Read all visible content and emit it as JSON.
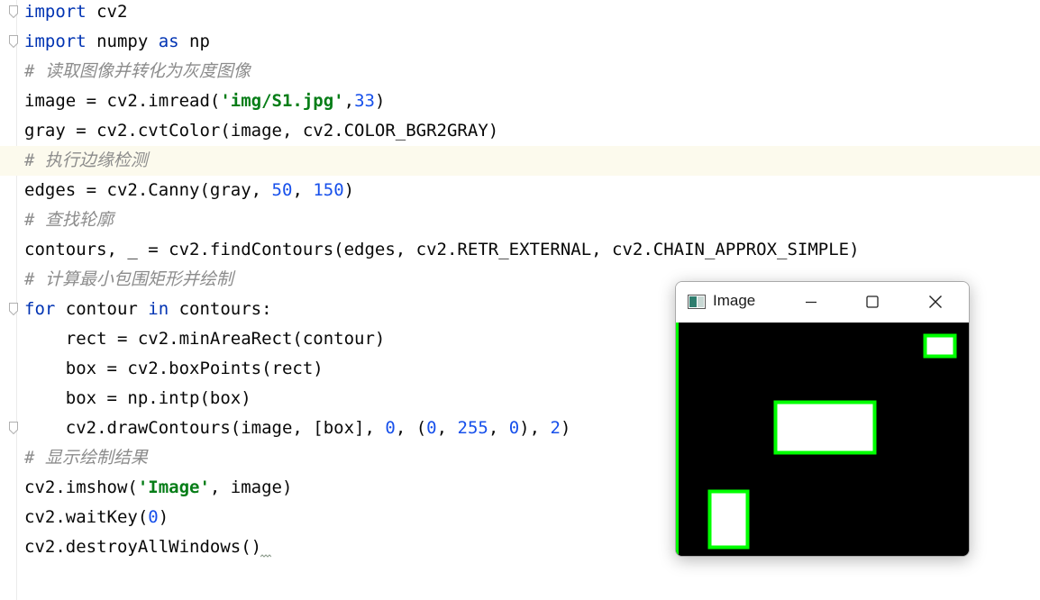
{
  "editor": {
    "lines": [
      {
        "tokens": [
          {
            "t": "import",
            "c": "kw"
          },
          {
            "t": " cv2",
            "c": ""
          }
        ]
      },
      {
        "tokens": [
          {
            "t": "import",
            "c": "kw"
          },
          {
            "t": " numpy ",
            "c": ""
          },
          {
            "t": "as",
            "c": "kw"
          },
          {
            "t": " np",
            "c": ""
          }
        ]
      },
      {
        "tokens": [
          {
            "t": "# 读取图像并转化为灰度图像",
            "c": "cmt"
          }
        ]
      },
      {
        "tokens": [
          {
            "t": "image = cv2.imread(",
            "c": ""
          },
          {
            "t": "'img/S1.jpg'",
            "c": "str"
          },
          {
            "t": ",",
            "c": ""
          },
          {
            "t": "33",
            "c": "num"
          },
          {
            "t": ")",
            "c": ""
          }
        ]
      },
      {
        "tokens": [
          {
            "t": "gray = cv2.cvtColor(image, cv2.COLOR_BGR2GRAY)",
            "c": ""
          }
        ]
      },
      {
        "tokens": [
          {
            "t": "# 执行边缘检测",
            "c": "cmt"
          }
        ]
      },
      {
        "tokens": [
          {
            "t": "edges = cv2.Canny(gray, ",
            "c": ""
          },
          {
            "t": "50",
            "c": "num"
          },
          {
            "t": ", ",
            "c": ""
          },
          {
            "t": "150",
            "c": "num"
          },
          {
            "t": ")",
            "c": ""
          }
        ]
      },
      {
        "tokens": [
          {
            "t": "# 查找轮廓",
            "c": "cmt"
          }
        ]
      },
      {
        "tokens": [
          {
            "t": "contours, _ = cv2.findContours(edges, cv2.RETR_EXTERNAL, cv2.CHAIN_APPROX_SIMPLE)",
            "c": ""
          }
        ]
      },
      {
        "tokens": [
          {
            "t": "# 计算最小包围矩形并绘制",
            "c": "cmt"
          }
        ]
      },
      {
        "tokens": [
          {
            "t": "for",
            "c": "kw"
          },
          {
            "t": " contour ",
            "c": ""
          },
          {
            "t": "in",
            "c": "kw"
          },
          {
            "t": " contours:",
            "c": ""
          }
        ]
      },
      {
        "tokens": [
          {
            "t": "    rect = cv2.minAreaRect(contour)",
            "c": ""
          }
        ]
      },
      {
        "tokens": [
          {
            "t": "    box = cv2.boxPoints(rect)",
            "c": ""
          }
        ]
      },
      {
        "tokens": [
          {
            "t": "    box = np.intp(box)",
            "c": ""
          }
        ]
      },
      {
        "tokens": [
          {
            "t": "    cv2.drawContours(image, [box], ",
            "c": ""
          },
          {
            "t": "0",
            "c": "num"
          },
          {
            "t": ", (",
            "c": ""
          },
          {
            "t": "0",
            "c": "num"
          },
          {
            "t": ", ",
            "c": ""
          },
          {
            "t": "255",
            "c": "num"
          },
          {
            "t": ", ",
            "c": ""
          },
          {
            "t": "0",
            "c": "num"
          },
          {
            "t": "), ",
            "c": ""
          },
          {
            "t": "2",
            "c": "num"
          },
          {
            "t": ")",
            "c": ""
          }
        ]
      },
      {
        "tokens": [
          {
            "t": "# 显示绘制结果",
            "c": "cmt"
          }
        ]
      },
      {
        "tokens": [
          {
            "t": "cv2.imshow(",
            "c": ""
          },
          {
            "t": "'Image'",
            "c": "str"
          },
          {
            "t": ", image)",
            "c": ""
          }
        ]
      },
      {
        "tokens": [
          {
            "t": "cv2.waitKey(",
            "c": ""
          },
          {
            "t": "0",
            "c": "num"
          },
          {
            "t": ")",
            "c": ""
          }
        ]
      },
      {
        "tokens": [
          {
            "t": "cv2.destroyAllWindows()",
            "c": ""
          }
        ]
      }
    ],
    "current_line": 5,
    "fold_markers": [
      0,
      1,
      10,
      14
    ]
  },
  "image_window": {
    "title": "Image",
    "app_icon": "image-app-icon",
    "controls": [
      "minimize-icon",
      "maximize-icon",
      "close-icon"
    ],
    "colors": {
      "background": "#000000",
      "fill": "#ffffff",
      "contour": "#00ff00"
    }
  }
}
